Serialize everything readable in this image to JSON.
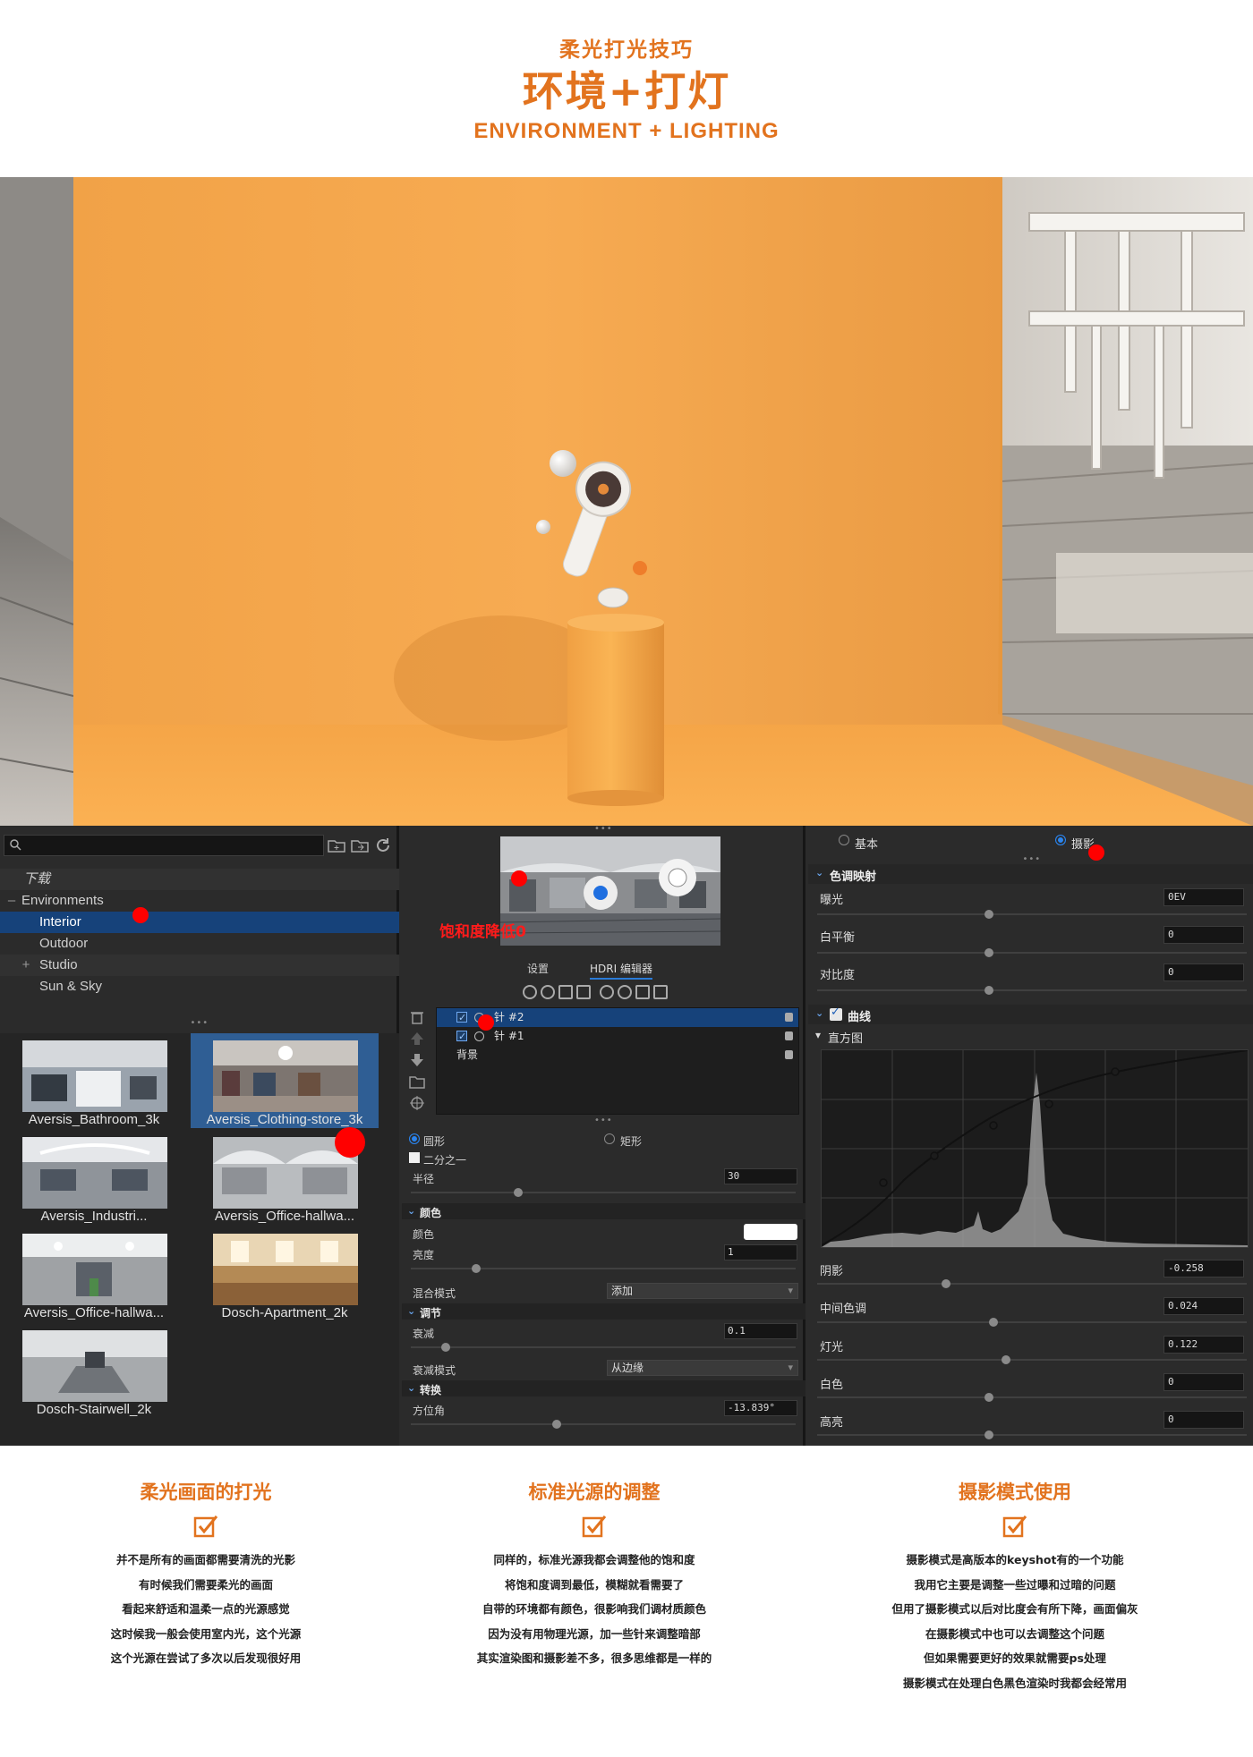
{
  "header": {
    "subtitle": "柔光打光技巧",
    "title": "环境+打灯",
    "english": "ENVIRONMENT + LIGHTING"
  },
  "colors": {
    "accent": "#e2731e",
    "selection": "#16427a",
    "marker": "#ff0000"
  },
  "left_panel": {
    "search_placeholder": "",
    "icons": [
      "search-icon",
      "folder-add-icon",
      "folder-import-icon",
      "refresh-icon"
    ],
    "tree": [
      {
        "label": "下载",
        "toggle": ""
      },
      {
        "label": "Environments",
        "toggle": "–"
      },
      {
        "label": "Interior",
        "toggle": ""
      },
      {
        "label": "Outdoor",
        "toggle": ""
      },
      {
        "label": "Studio",
        "toggle": "+"
      },
      {
        "label": "Sun & Sky",
        "toggle": ""
      }
    ],
    "thumbnails": [
      "Aversis_Bathroom_3k",
      "Aversis_Clothing-store_3k",
      "Aversis_Industri...",
      "Aversis_Office-hallwa...",
      "Aversis_Office-hallwa...",
      "Dosch-Apartment_2k",
      "Dosch-Stairwell_2k"
    ]
  },
  "mid_panel": {
    "note": "饱和度降低0",
    "tabs": [
      "设置",
      "HDRI 编辑器"
    ],
    "pins": [
      "针 #2",
      "针 #1",
      "背景"
    ],
    "shape_options": [
      "圆形",
      "矩形"
    ],
    "half_label": "二分之一",
    "radius_label": "半径",
    "radius_value": "30",
    "radius_level": 0.28,
    "color_section": "颜色",
    "color_label": "颜色",
    "brightness_label": "亮度",
    "brightness_value": "1",
    "brightness_level": 0.17,
    "blend_label": "混合模式",
    "blend_value": "添加",
    "adjust_section": "调节",
    "falloff_label": "衰减",
    "falloff_value": "0.1",
    "falloff_level": 0.09,
    "falloff_mode_label": "衰减模式",
    "falloff_mode_value": "从边缘",
    "transform_section": "转换",
    "azimuth_label": "方位角",
    "azimuth_value": "-13.839°",
    "azimuth_level": 0.38
  },
  "right_panel": {
    "modes": [
      "基本",
      "摄影"
    ],
    "tone_section": "色调映射",
    "exposure_label": "曝光",
    "exposure_value": "0EV",
    "exposure_level": 0.4,
    "wb_label": "白平衡",
    "wb_value": "0",
    "wb_level": 0.4,
    "contrast_label": "对比度",
    "contrast_value": "0",
    "contrast_level": 0.4,
    "curve_section": "曲线",
    "histogram_label": "直方图",
    "shadow_label": "阴影",
    "shadow_value": "-0.258",
    "shadow_level": 0.3,
    "mid_label": "中间色调",
    "mid_value": "0.024",
    "mid_level": 0.41,
    "light_label": "灯光",
    "light_value": "0.122",
    "light_level": 0.44,
    "white_label": "白色",
    "white_value": "0",
    "white_level": 0.4,
    "high_label": "高亮",
    "high_value": "0",
    "high_level": 0.4
  },
  "columns": [
    {
      "title": "柔光画面的打光",
      "lines": [
        "并不是所有的画面都需要清洗的光影",
        "有时候我们需要柔光的画面",
        "看起来舒适和温柔一点的光源感觉",
        "这时候我一般会使用室内光，这个光源",
        "这个光源在尝试了多次以后发现很好用"
      ]
    },
    {
      "title": "标准光源的调整",
      "lines": [
        "同样的，标准光源我都会调整他的饱和度",
        "将饱和度调到最低，模糊就看需要了",
        "自带的环境都有颜色，很影响我们调材质颜色",
        "因为没有用物理光源，加一些针来调整暗部",
        "其实渲染图和摄影差不多，很多思维都是一样的"
      ]
    },
    {
      "title": "摄影模式使用",
      "lines": [
        "摄影模式是高版本的keyshot有的一个功能",
        "我用它主要是调整一些过曝和过暗的问题",
        "但用了摄影模式以后对比度会有所下降，画面偏灰",
        "在摄影模式中也可以去调整这个问题",
        "但如果需要更好的效果就需要ps处理",
        "摄影模式在处理白色黑色渲染时我都会经常用"
      ]
    }
  ]
}
